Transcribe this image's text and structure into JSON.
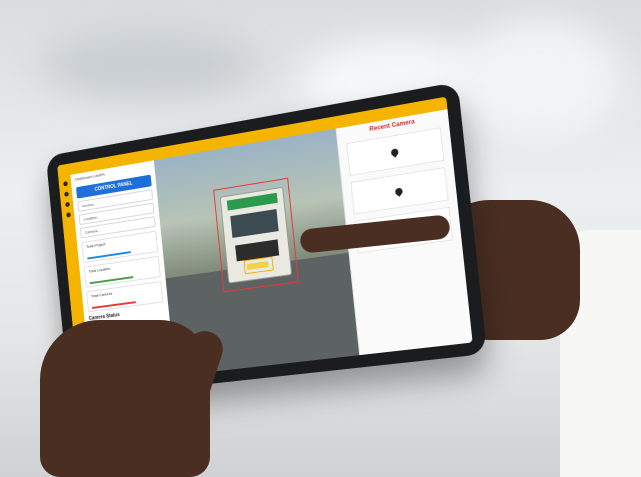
{
  "dashboard": {
    "breadcrumb": "Dashboard / ANPR",
    "control_panel_label": "CONTROL PANEL",
    "fields": [
      "Invoice...",
      "Location...",
      "Camera..."
    ],
    "stats": [
      {
        "label": "Total Project",
        "color": "#1e88e5"
      },
      {
        "label": "Total Location",
        "color": "#43a047"
      },
      {
        "label": "Total Camera",
        "color": "#e53935"
      }
    ],
    "camera_status_label": "Camera Status",
    "recent_title": "Recent Camera",
    "recent_items": [
      {
        "icon": "map-pin-icon"
      },
      {
        "icon": "map-pin-icon"
      },
      {
        "icon": "map-pin-icon"
      }
    ]
  },
  "colors": {
    "accent": "#f4b400",
    "primary_button": "#1e6fd9",
    "detection_box": "#e53935"
  }
}
